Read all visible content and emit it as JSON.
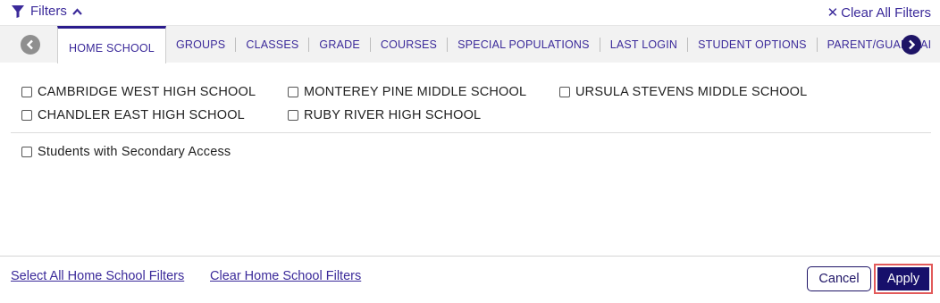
{
  "header": {
    "filters_label": "Filters",
    "clear_all_label": "Clear All Filters"
  },
  "tabs": [
    {
      "label": "HOME SCHOOL",
      "active": true
    },
    {
      "label": "GROUPS"
    },
    {
      "label": "CLASSES"
    },
    {
      "label": "GRADE"
    },
    {
      "label": "COURSES"
    },
    {
      "label": "SPECIAL POPULATIONS"
    },
    {
      "label": "LAST LOGIN"
    },
    {
      "label": "STUDENT OPTIONS"
    },
    {
      "label": "PARENT/GUARDIAI"
    }
  ],
  "schools": [
    {
      "label": "CAMBRIDGE WEST HIGH SCHOOL",
      "checked": false
    },
    {
      "label": "CHANDLER EAST HIGH SCHOOL",
      "checked": false
    },
    {
      "label": "MONTEREY PINE MIDDLE SCHOOL",
      "checked": false
    },
    {
      "label": "RUBY RIVER HIGH SCHOOL",
      "checked": false
    },
    {
      "label": "URSULA STEVENS MIDDLE SCHOOL",
      "checked": false
    }
  ],
  "secondary_access": {
    "label": "Students with Secondary Access",
    "checked": false
  },
  "footer": {
    "select_all_label": "Select All Home School Filters",
    "clear_label": "Clear Home School Filters",
    "cancel_label": "Cancel",
    "apply_label": "Apply"
  },
  "colors": {
    "accent": "#3b2a9a",
    "primary_button": "#17106b",
    "highlight": "#e25a5a"
  }
}
